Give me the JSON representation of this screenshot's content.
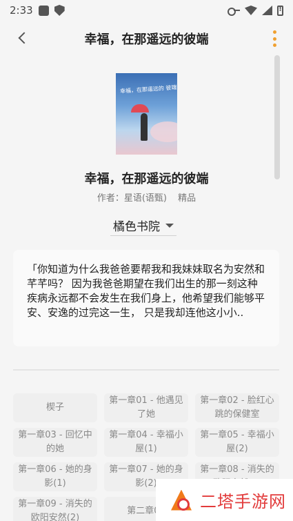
{
  "status_bar": {
    "time": "2:33"
  },
  "header": {
    "title": "幸福，在那遥远的彼端"
  },
  "book": {
    "title": "幸福，在那遥远的彼端",
    "author_label": "作者：星语(语甄)",
    "tag": "精品",
    "cover_text": "幸福，在那遥远的 彼端"
  },
  "source": {
    "label": "橘色书院"
  },
  "description": "「你知道为什么我爸爸要帮我和我妹妹取名为安然和芊芊吗？ 因为我爸爸期望在我们出生的那一刻这种疾病永远都不会发生在我们身上，他希望我们能够平安、安逸的过完这一生， 只是我却连他这小小..",
  "chapters": [
    "楔子",
    "第一章01 - 他遇见了她",
    "第一章02 - 脸红心跳的保健室",
    "第一章03 - 回忆中的她",
    "第一章04 - 幸福小屋(1)",
    "第一章05 - 幸福小屋(2)",
    "第一章06 - 她的身影(1)",
    "第一章07 - 她的身影(2)",
    "第一章08 - 消失的欧阳安然(1)",
    "第一章09 - 消失的欧阳安然(2)",
    "第二章01",
    ""
  ],
  "watermark": {
    "text": "二塔手游网"
  },
  "colors": {
    "accent": "#f0a030",
    "watermark": "#e23b3b"
  }
}
